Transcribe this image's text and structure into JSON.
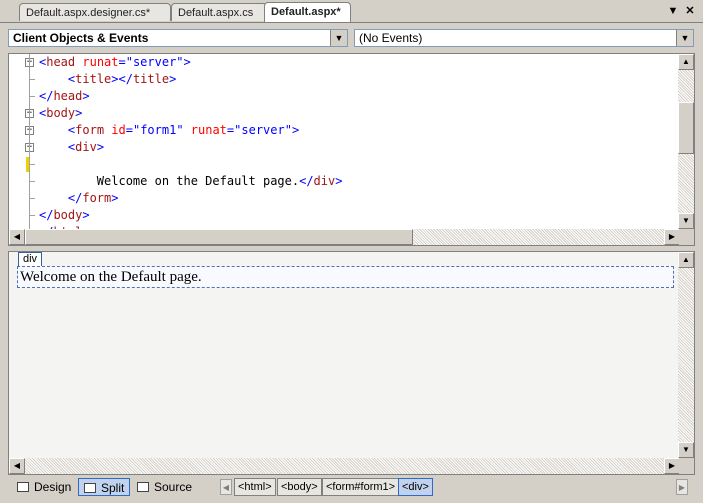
{
  "tabs": [
    {
      "label": "Default.aspx.designer.cs*"
    },
    {
      "label": "Default.aspx.cs"
    },
    {
      "label": "Default.aspx*"
    }
  ],
  "window_buttons": {
    "dropdown": "▼",
    "close": "✕"
  },
  "dropdowns": {
    "objects": "Client Objects & Events",
    "events": "(No Events)"
  },
  "code_lines": [
    {
      "indent": "",
      "parts": [
        [
          "punct",
          "<"
        ],
        [
          "tag",
          "head"
        ],
        [
          "plain",
          " "
        ],
        [
          "attr",
          "runat"
        ],
        [
          "punct",
          "="
        ],
        [
          "val",
          "\"server\""
        ],
        [
          "punct",
          ">"
        ]
      ]
    },
    {
      "indent": "    ",
      "parts": [
        [
          "punct",
          "<"
        ],
        [
          "tag",
          "title"
        ],
        [
          "punct",
          "></"
        ],
        [
          "tag",
          "title"
        ],
        [
          "punct",
          ">"
        ]
      ]
    },
    {
      "indent": "",
      "parts": [
        [
          "punct",
          "</"
        ],
        [
          "tag",
          "head"
        ],
        [
          "punct",
          ">"
        ]
      ]
    },
    {
      "indent": "",
      "parts": [
        [
          "punct",
          "<"
        ],
        [
          "tag",
          "body"
        ],
        [
          "punct",
          ">"
        ]
      ]
    },
    {
      "indent": "    ",
      "parts": [
        [
          "punct",
          "<"
        ],
        [
          "tag",
          "form"
        ],
        [
          "plain",
          " "
        ],
        [
          "attr",
          "id"
        ],
        [
          "punct",
          "="
        ],
        [
          "val",
          "\"form1\""
        ],
        [
          "plain",
          " "
        ],
        [
          "attr",
          "runat"
        ],
        [
          "punct",
          "="
        ],
        [
          "val",
          "\"server\""
        ],
        [
          "punct",
          ">"
        ]
      ]
    },
    {
      "indent": "    ",
      "parts": [
        [
          "punct",
          "<"
        ],
        [
          "tag",
          "div"
        ],
        [
          "punct",
          ">"
        ]
      ]
    },
    {
      "indent": "",
      "parts": [
        [
          "plain",
          ""
        ]
      ]
    },
    {
      "indent": "        ",
      "parts": [
        [
          "plain",
          "Welcome on the Default page."
        ],
        [
          "punct",
          "</"
        ],
        [
          "tag",
          "div"
        ],
        [
          "punct",
          ">"
        ]
      ]
    },
    {
      "indent": "    ",
      "parts": [
        [
          "punct",
          "</"
        ],
        [
          "tag",
          "form"
        ],
        [
          "punct",
          ">"
        ]
      ]
    },
    {
      "indent": "",
      "parts": [
        [
          "punct",
          "</"
        ],
        [
          "tag",
          "body"
        ],
        [
          "punct",
          ">"
        ]
      ]
    },
    {
      "indent": "",
      "parts": [
        [
          "punct",
          "</"
        ],
        [
          "tag",
          "html"
        ],
        [
          "punct",
          ">"
        ]
      ]
    }
  ],
  "design": {
    "div_label": "div",
    "text": "Welcome on the Default page."
  },
  "view_buttons": {
    "design": "Design",
    "split": "Split",
    "source": "Source"
  },
  "breadcrumbs": [
    "<html>",
    "<body>",
    "<form#form1>",
    "<div>"
  ],
  "colors": {
    "accent": "#316ac5",
    "tag": "#a31515",
    "attribute": "#ff0000",
    "value": "#0000ff"
  }
}
